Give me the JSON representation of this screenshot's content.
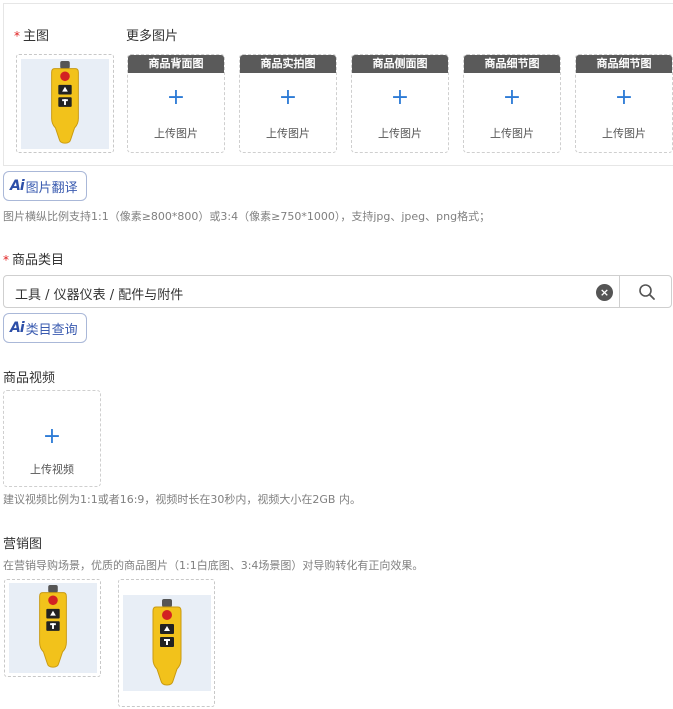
{
  "images": {
    "main_label": "主图",
    "more_label": "更多图片",
    "slots": [
      {
        "title": "商品背面图",
        "upload": "上传图片"
      },
      {
        "title": "商品实拍图",
        "upload": "上传图片"
      },
      {
        "title": "商品侧面图",
        "upload": "上传图片"
      },
      {
        "title": "商品细节图",
        "upload": "上传图片"
      },
      {
        "title": "商品细节图",
        "upload": "上传图片"
      }
    ],
    "translate_btn": "图片翻译",
    "hint": "图片横纵比例支持1:1（像素≥800*800）或3:4（像素≥750*1000），支持jpg、jpeg、png格式；"
  },
  "ai_mark": "Ai",
  "category": {
    "label": "商品类目",
    "value": "工具 / 仪器仪表 / 配件与附件",
    "query_btn": "类目查询"
  },
  "video": {
    "label": "商品视频",
    "upload": "上传视频",
    "hint": "建议视频比例为1:1或者16:9，视频时长在30秒内，视频大小在2GB 内。"
  },
  "marketing": {
    "label": "营销图",
    "hint": "在营销导购场景，优质的商品图片（1:1白底图、3:4场景图）对导购转化有正向效果。"
  },
  "colors": {
    "accent": "#2d7bd6",
    "required": "#e02020",
    "product_yellow": "#f2c21b"
  }
}
